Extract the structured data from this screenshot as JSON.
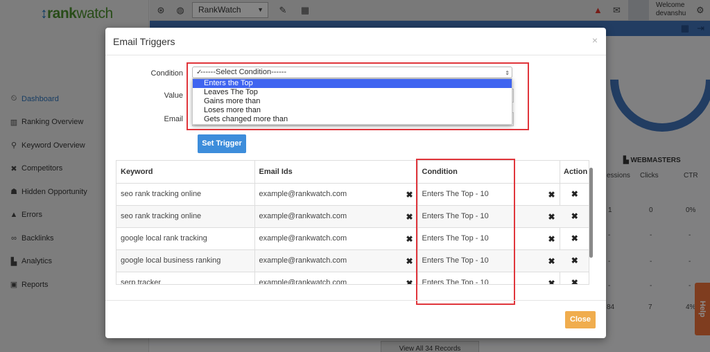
{
  "app": {
    "logo": {
      "arrow": "↕",
      "rank": "rank",
      "watch": "watch"
    },
    "topbar": {
      "project_select": "RankWatch",
      "welcome_line1": "Welcome",
      "welcome_line2": "devanshu"
    },
    "sidebar": {
      "items": [
        {
          "label": "Dashboard",
          "icon": "⏲",
          "active": true
        },
        {
          "label": "Ranking Overview",
          "icon": "▥"
        },
        {
          "label": "Keyword Overview",
          "icon": "⚲"
        },
        {
          "label": "Competitors",
          "icon": "✖"
        },
        {
          "label": "Hidden Opportunity",
          "icon": "☗"
        },
        {
          "label": "Errors",
          "icon": "▲"
        },
        {
          "label": "Backlinks",
          "icon": "∞"
        },
        {
          "label": "Analytics",
          "icon": "▙"
        },
        {
          "label": "Reports",
          "icon": "▣"
        }
      ]
    },
    "webmasters": {
      "title": "WEBMASTERS",
      "columns": [
        "essions",
        "Clicks",
        "CTR"
      ],
      "row1": [
        "1",
        "0",
        "0%"
      ],
      "dash": "-",
      "row_last": [
        "84",
        "7",
        "4%"
      ]
    },
    "help_label": "Help",
    "view_all_label": "View All 34 Records"
  },
  "modal": {
    "title": "Email Triggers",
    "close_symbol": "×",
    "labels": {
      "condition": "Condition",
      "value": "Value",
      "email": "Email"
    },
    "condition_select": {
      "placeholder": "------Select Condition------",
      "options": [
        "Enters the Top",
        "Leaves The Top",
        "Gains more than",
        "Loses more than",
        "Gets changed more than"
      ],
      "highlighted_index": 0
    },
    "set_trigger_label": "Set Trigger",
    "table": {
      "headers": [
        "Keyword",
        "Email Ids",
        "Condition",
        "",
        "Action"
      ],
      "rows": [
        {
          "keyword": "seo rank tracking online",
          "email": "example@rankwatch.com",
          "condition": "Enters The Top - 10"
        },
        {
          "keyword": "seo rank tracking online",
          "email": "example@rankwatch.com",
          "condition": "Enters The Top - 10"
        },
        {
          "keyword": "google local rank tracking",
          "email": "example@rankwatch.com",
          "condition": "Enters The Top - 10"
        },
        {
          "keyword": "google local business ranking",
          "email": "example@rankwatch.com",
          "condition": "Enters The Top - 10"
        },
        {
          "keyword": "serp tracker",
          "email": "example@rankwatch.com",
          "condition": "Enters The Top - 10"
        }
      ],
      "delete_symbol": "✖"
    },
    "close_button_label": "Close"
  },
  "colors": {
    "accent": "#3d8ddb",
    "close_button": "#f0ad4e",
    "highlight_box": "#e0353b",
    "help_tab": "#e86f3a"
  }
}
